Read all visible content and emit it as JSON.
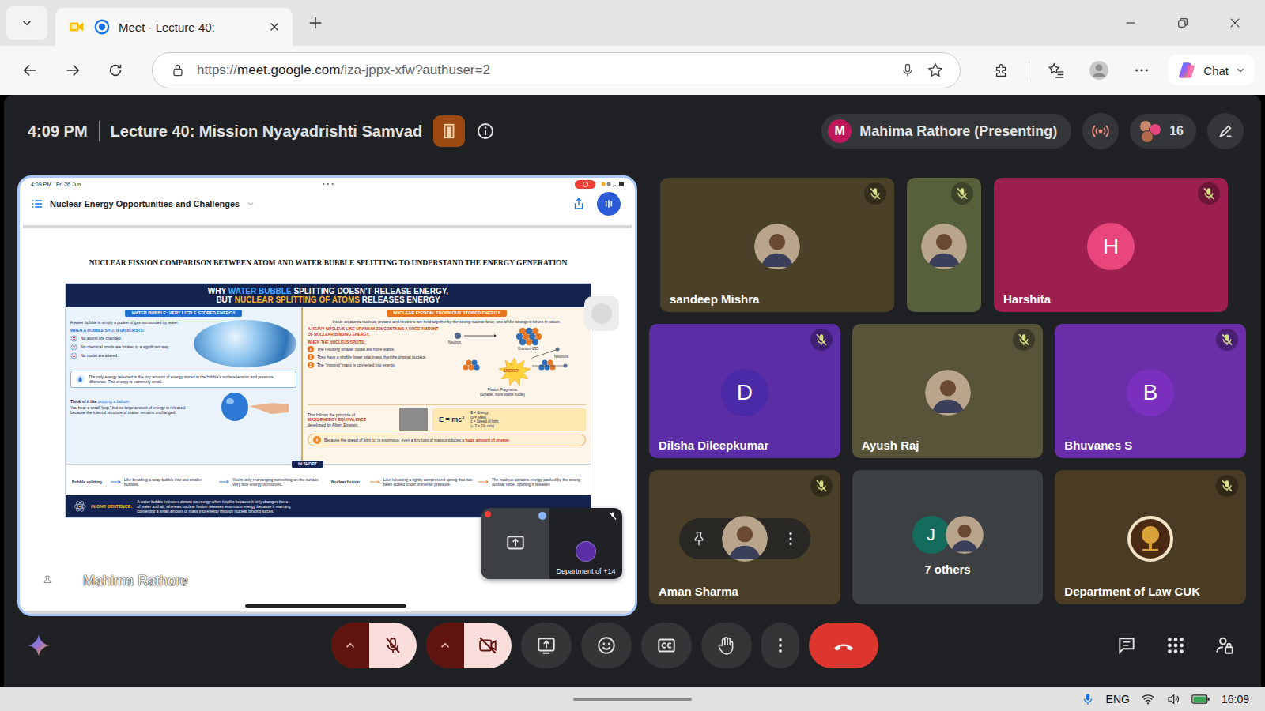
{
  "browser": {
    "tab": {
      "title": "Meet - Lecture 40:",
      "selected": true
    },
    "address": {
      "scheme": "https://",
      "host": "meet.google.com",
      "path": "/iza-jppx-xfw?authuser=2"
    },
    "copilot_label": "Chat"
  },
  "meeting": {
    "time": "4:09 PM",
    "title": "Lecture 40: Mission Nyayadrishti Samvad",
    "presenter_initial": "M",
    "presenter": "Mahima Rathore (Presenting)",
    "participant_count": "16"
  },
  "presentation": {
    "device_time": "4:09 PM",
    "device_date": "Fri 26 Jun",
    "recording": true,
    "document_title": "Nuclear Energy Opportunities and Challenges",
    "page_heading": "NUCLEAR FISSION COMPARISON BETWEEN ATOM AND WATER BUBBLE SPLITTING TO UNDERSTAND THE ENERGY GENERATION",
    "infographic": {
      "headline": [
        [
          {
            "text": "WHY ",
            "color": "#ffffff"
          },
          {
            "text": "WATER BUBBLE",
            "color": "#4aa8ff"
          },
          {
            "text": " SPLITTING DOESN'T RELEASE ENERGY,",
            "color": "#ffffff"
          }
        ],
        [
          {
            "text": "BUT ",
            "color": "#ffffff"
          },
          {
            "text": "NUCLEAR SPLITTING OF ATOMS",
            "color": "#ffb524"
          },
          {
            "text": " RELEASES ENERGY",
            "color": "#ffffff"
          }
        ]
      ],
      "left": {
        "header": "WATER BUBBLE: VERY LITTLE STORED ENERGY",
        "intro": "A water bubble is simply a pocket of gas surrounded by water.",
        "subhead": "WHEN A BUBBLE SPLITS OR BURSTS:",
        "points": [
          "No atoms are changed.",
          "No chemical bonds are broken in a significant way.",
          "No nuclei are altered."
        ],
        "note": "The only energy released is the tiny amount of energy stored in the bubble's surface tension and pressure difference. This energy is extremely small.",
        "analogy_lead": "Think of it like ",
        "analogy_highlight": "popping a balloon.",
        "analogy": "You hear a small \"pop,\" but no large amount of energy is released because the internal structure of matter remains unchanged."
      },
      "right": {
        "header": "NUCLEAR FISSION: ENORMOUS STORED ENERGY",
        "intro": "Inside an atomic nucleus, protons and neutrons are held together by the strong nuclear force, one of the strongest forces in nature.",
        "claim": "A HEAVY NUCLEUS LIKE URANIUM-235 CONTAINS A HUGE AMOUNT OF NUCLEAR BINDING ENERGY.",
        "diagram": {
          "neutron": "Neutron",
          "nucleus": "Uranium-235",
          "energy": "ENERGY",
          "neutrons": "Neutrons",
          "fragments": "Fission Fragments",
          "fragments_note": "(Smaller, more stable nuclei)"
        },
        "subhead": "WHEN THE NUCLEUS SPLITS:",
        "steps": [
          {
            "number": "1",
            "text": "The resulting smaller nuclei are more stable."
          },
          {
            "number": "2",
            "text": "They have a slightly lower total mass than the original nucleus."
          },
          {
            "number": "3",
            "text": "The \"missing\" mass is converted into energy."
          }
        ],
        "principle_lead": "This follows the principle of",
        "principle": "MASS-ENERGY EQUIVALENCE",
        "principle_tail": "developed by Albert Einstein.",
        "formula": "E = mc²",
        "legend": [
          "E = Energy",
          "m = Mass",
          "c = Speed of light",
          "(≈ 3 × 10⁸ m/s)"
        ],
        "conclusion_lead": "Because the speed of light (c) is enormous, even a tiny loss of mass produces a ",
        "conclusion_highlight": "huge amount of energy."
      },
      "summary_label": "IN SHORT",
      "summary": [
        {
          "term": "Bubble splitting",
          "analogy": "Like breaking a soap bubble into two smaller bubbles.",
          "meaning": "You're only rearranging something on the surface. Very little energy is involved."
        },
        {
          "term": "Nuclear fission",
          "analogy": "Like releasing a tightly compressed spring that has been locked under immense pressure.",
          "meaning": "The nucleus contains energy packed by the strong nuclear force. Splitting it releases"
        }
      ],
      "sentence_label": "IN ONE SENTENCE:",
      "sentence": [
        "A water bubble releases almost no energy when it splits because it only changes the a",
        "of water and air, whereas nuclear fission releases enormous energy because it rearrang",
        "converting a small amount of mass into energy through nuclear binding forces."
      ]
    },
    "presenter_label": "Mahima Rathore",
    "self_view": {
      "label": "Department of +14"
    }
  },
  "participants": [
    {
      "name": "sandeep Mishra",
      "kind": "photo",
      "muted": true,
      "hovered": false,
      "color": "#4b4129"
    },
    {
      "kind": "photo",
      "muted": true,
      "hovered": false,
      "color": "#56603a"
    },
    {
      "name": "Harshita",
      "kind": "avatar",
      "initial": "H",
      "avatar_color": "#e8467c",
      "muted": true,
      "hovered": false,
      "color": "#9c1f4f"
    },
    {
      "name": "Dilsha Dileepkumar",
      "kind": "avatar",
      "initial": "D",
      "avatar_color": "#4b2aa8",
      "muted": true,
      "hovered": false,
      "color": "#5b2ea6"
    },
    {
      "name": "Ayush Raj",
      "kind": "photo",
      "muted": true,
      "hovered": false,
      "color": "#57543a"
    },
    {
      "name": "Bhuvanes S",
      "kind": "avatar",
      "initial": "B",
      "avatar_color": "#7b2fbf",
      "muted": true,
      "hovered": false,
      "color": "#6a2fa8"
    },
    {
      "name": "Aman Sharma",
      "kind": "photo",
      "muted": true,
      "hovered": true,
      "color": "#4a3f28"
    },
    {
      "name": "7 others",
      "kind": "group",
      "muted": false,
      "hovered": false,
      "color": "#3c4043",
      "members": [
        {
          "kind": "avatar",
          "initial": "J",
          "avatar_color": "#146c5c"
        },
        {
          "kind": "photo"
        }
      ]
    },
    {
      "name": "Department of Law CUK",
      "kind": "logo",
      "muted": true,
      "hovered": false,
      "color": "#4a3b24"
    }
  ],
  "controls": {
    "microphone_on": false,
    "camera_on": false
  },
  "taskbar": {
    "language": "ENG",
    "time": "16:09"
  }
}
